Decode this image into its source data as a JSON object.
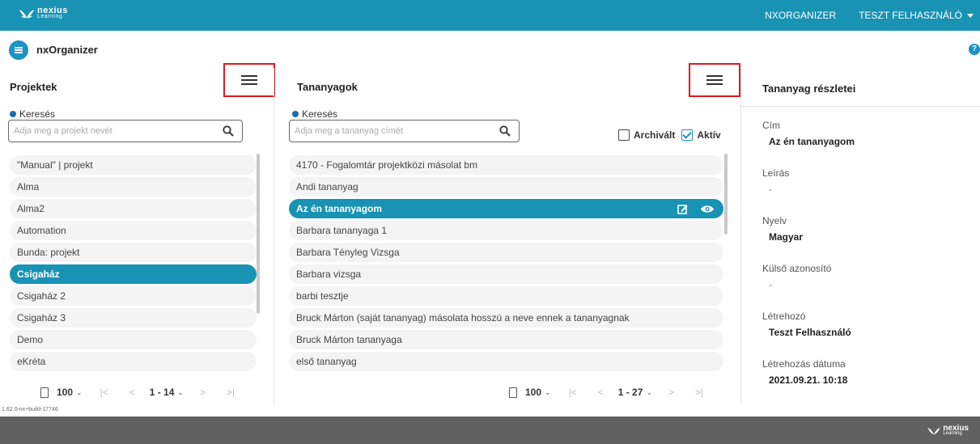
{
  "brand": {
    "name": "nexius",
    "sub": "Learning"
  },
  "topnav": {
    "link": "NXORGANIZER",
    "user": "TESZT FELHASZNÁLÓ"
  },
  "app": {
    "title": "nxOrganizer",
    "help": "?"
  },
  "projects": {
    "title": "Projektek",
    "search_label": "Keresés",
    "search_placeholder": "Adja meg a projekt nevét",
    "items": [
      {
        "label": "\"Manual\" | projekt",
        "selected": false
      },
      {
        "label": "Alma",
        "selected": false
      },
      {
        "label": "Alma2",
        "selected": false
      },
      {
        "label": "Automation",
        "selected": false
      },
      {
        "label": "Bunda: projekt",
        "selected": false
      },
      {
        "label": "Csigaház",
        "selected": true
      },
      {
        "label": "Csigaház 2",
        "selected": false
      },
      {
        "label": "Csigaház 3",
        "selected": false
      },
      {
        "label": "Demo",
        "selected": false
      },
      {
        "label": "eKréta",
        "selected": false
      }
    ],
    "page_size": "100",
    "range": "1 - 14"
  },
  "materials": {
    "title": "Tananyagok",
    "search_label": "Keresés",
    "search_placeholder": "Adja meg a tananyag címét",
    "archived_label": "Archivált",
    "archived_checked": false,
    "active_label": "Aktív",
    "active_checked": true,
    "items": [
      {
        "label": "4170 - Fogalomtár projektközi másolat bm",
        "selected": false
      },
      {
        "label": "Andi tananyag",
        "selected": false
      },
      {
        "label": "Az én tananyagom",
        "selected": true
      },
      {
        "label": "Barbara tananyaga 1",
        "selected": false
      },
      {
        "label": "Barbara Tényleg Vizsga",
        "selected": false
      },
      {
        "label": "Barbara vizsga",
        "selected": false
      },
      {
        "label": "barbi tesztje",
        "selected": false
      },
      {
        "label": "Bruck Márton (saját tananyag) másolata hosszú a neve ennek a tananyagnak",
        "selected": false
      },
      {
        "label": "Bruck Márton tananyaga",
        "selected": false
      },
      {
        "label": "első tananyag",
        "selected": false
      }
    ],
    "page_size": "100",
    "range": "1 - 27"
  },
  "details": {
    "title": "Tananyag részletei",
    "fields": [
      {
        "label": "Cím",
        "value": "Az én tananyagom"
      },
      {
        "label": "Leírás",
        "value": "-"
      },
      {
        "label": "Nyelv",
        "value": "Magyar"
      },
      {
        "label": "Külső azonosító",
        "value": "-"
      },
      {
        "label": "Létrehozó",
        "value": "Teszt Felhasználó"
      },
      {
        "label": "Létrehozás dátuma",
        "value": "2021.09.21. 10:18"
      }
    ]
  },
  "version": "1.62.0-nx+build-17746",
  "colors": {
    "primary": "#1893b3",
    "highlight_box": "#e0191f",
    "footer": "#616161"
  }
}
